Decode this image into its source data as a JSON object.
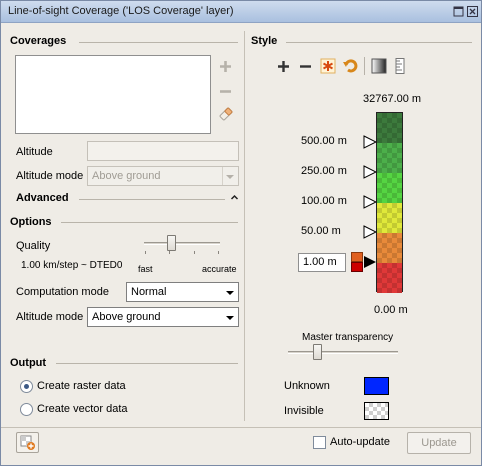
{
  "window": {
    "title": "Line-of-sight Coverage ('LOS Coverage' layer)"
  },
  "coverages": {
    "section_title": "Coverages",
    "altitude_label": "Altitude",
    "altitude_value": "",
    "altitude_mode_label": "Altitude mode",
    "altitude_mode_value": "Above ground"
  },
  "advanced": {
    "title": "Advanced"
  },
  "options": {
    "section_title": "Options",
    "quality_label": "Quality",
    "quality_value_text": "1.00 km/step ~ DTED0",
    "quality_min_label": "fast",
    "quality_max_label": "accurate",
    "quality_level": 0.35,
    "computation_mode_label": "Computation mode",
    "computation_mode_value": "Normal",
    "altitude_mode_label": "Altitude mode",
    "altitude_mode_value": "Above ground"
  },
  "output": {
    "section_title": "Output",
    "raster_label": "Create raster data",
    "vector_label": "Create vector data",
    "selected": "raster"
  },
  "style": {
    "section_title": "Style",
    "ramp_top_label": "32767.00 m",
    "ramp_bottom_label": "0.00 m",
    "ramp_labels": [
      "500.00 m",
      "250.00 m",
      "100.00 m",
      "50.00 m"
    ],
    "edit_value": "1.00 m",
    "ramp_colors": [
      "#3c7a3c",
      "#4caf4a",
      "#55d542",
      "#e0e83a",
      "#e88a3a",
      "#e03838"
    ],
    "master_transparency_label": "Master transparency",
    "master_transparency_level": 0.25,
    "unknown_label": "Unknown",
    "unknown_color": "#0026ff",
    "invisible_label": "Invisible"
  },
  "footer": {
    "auto_update_label": "Auto-update",
    "update_label": "Update"
  },
  "icons": {
    "add": "plus-icon",
    "remove": "minus-icon",
    "edit": "eraser-icon"
  }
}
